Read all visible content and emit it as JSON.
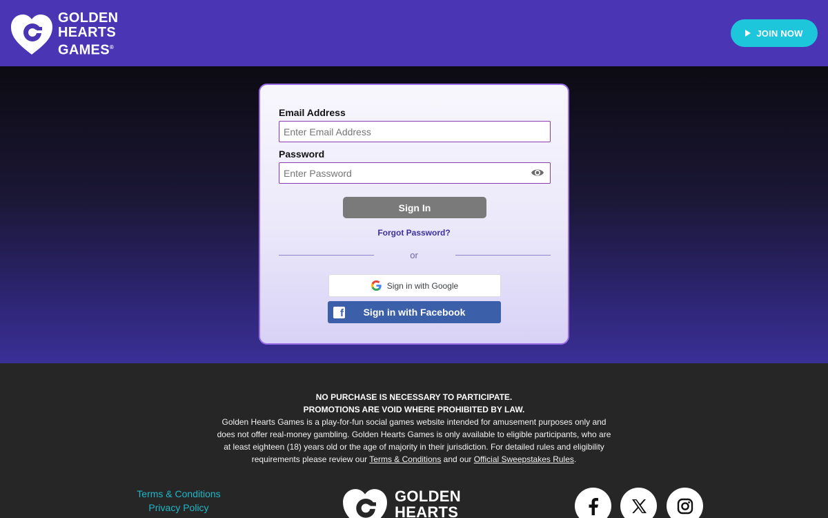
{
  "header": {
    "logo_lines": [
      "GOLDEN",
      "HEARTS",
      "GAMES"
    ],
    "logo_registered": "®",
    "join_label": "JOIN NOW"
  },
  "login": {
    "email_label": "Email Address",
    "email_placeholder": "Enter Email Address",
    "email_value": "",
    "password_label": "Password",
    "password_placeholder": "Enter Password",
    "password_value": "",
    "signin_label": "Sign In",
    "forgot_label": "Forgot Password?",
    "or_label": "or",
    "google_label": "Sign in with Google",
    "facebook_label": "Sign in with Facebook"
  },
  "footer": {
    "disclaimer_line1": "NO PURCHASE IS NECESSARY TO PARTICIPATE.",
    "disclaimer_line2": "PROMOTIONS ARE VOID WHERE PROHIBITED BY LAW.",
    "body_text": "Golden Hearts Games is a play-for-fun social games website intended for amusement purposes only and does not offer real-money gambling. Golden Hearts Games is only available to eligible participants, who are at least eighteen (18) years old or the age of majority in their jurisdiction. For detailed rules and eligibility requirements please review our",
    "terms_link": "Terms & Conditions",
    "and_text": "and our",
    "sweepstakes_link": "Official Sweepstakes Rules",
    "period": ".",
    "links": [
      "Terms & Conditions",
      "Privacy Policy"
    ],
    "logo_lines": [
      "GOLDEN",
      "HEARTS"
    ],
    "social_icons": [
      "facebook-icon",
      "x-icon",
      "instagram-icon"
    ]
  },
  "colors": {
    "header_bg": "#4a35b4",
    "accent_cyan": "#1ec6dc",
    "facebook_blue": "#3b5fa8",
    "card_border": "#9a6ce6",
    "link_cyan": "#1fb7c7"
  }
}
